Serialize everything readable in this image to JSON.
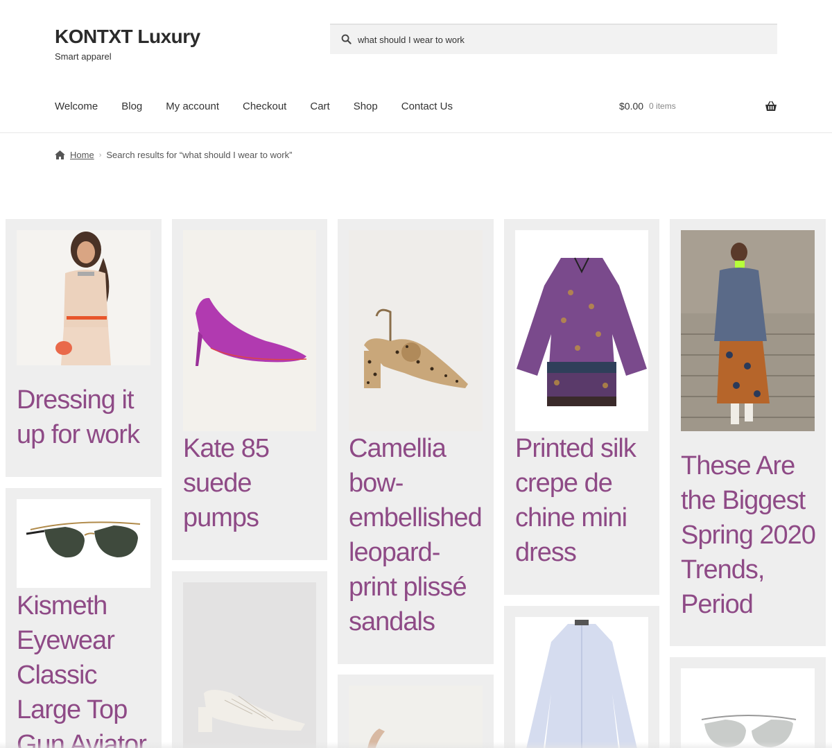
{
  "site": {
    "title": "KONTXT Luxury",
    "description": "Smart apparel"
  },
  "search": {
    "value": "what should I wear to work",
    "placeholder": ""
  },
  "nav": {
    "items": [
      {
        "label": "Welcome"
      },
      {
        "label": "Blog"
      },
      {
        "label": "My account"
      },
      {
        "label": "Checkout"
      },
      {
        "label": "Cart"
      },
      {
        "label": "Shop"
      },
      {
        "label": "Contact Us"
      }
    ]
  },
  "cart": {
    "amount": "$0.00",
    "count": "0 items"
  },
  "breadcrumb": {
    "home": "Home",
    "current": "Search results for “what should I wear to work”"
  },
  "results": [
    {
      "title": "Dressing it up for work",
      "image": "woman-in-beige-shirt-dress"
    },
    {
      "title": "Kate 85 suede pumps",
      "image": "magenta-suede-pump"
    },
    {
      "title": "Camellia bow-embellished leopard-print plissé sandals",
      "image": "leopard-print-sandal"
    },
    {
      "title": "Printed silk crepe de chine mini dress",
      "image": "purple-printed-dress"
    },
    {
      "title": "These Are the Biggest Spring 2020 Trends, Period",
      "image": "street-style-woman-blazer"
    },
    {
      "title": "Kismeth Eyewear Classic Large Top Gun Aviator",
      "image": "aviator-sunglasses"
    },
    {
      "title": "",
      "image": "white-woven-block-heel"
    },
    {
      "title": "",
      "image": "nude-sandal"
    },
    {
      "title": "",
      "image": "light-blue-shirt-dress"
    },
    {
      "title": "",
      "image": "silver-aviator-sunglasses"
    }
  ],
  "colors": {
    "accent": "#8e4a86",
    "card_bg": "#eeeeee",
    "search_bg": "#f2f2f2"
  }
}
